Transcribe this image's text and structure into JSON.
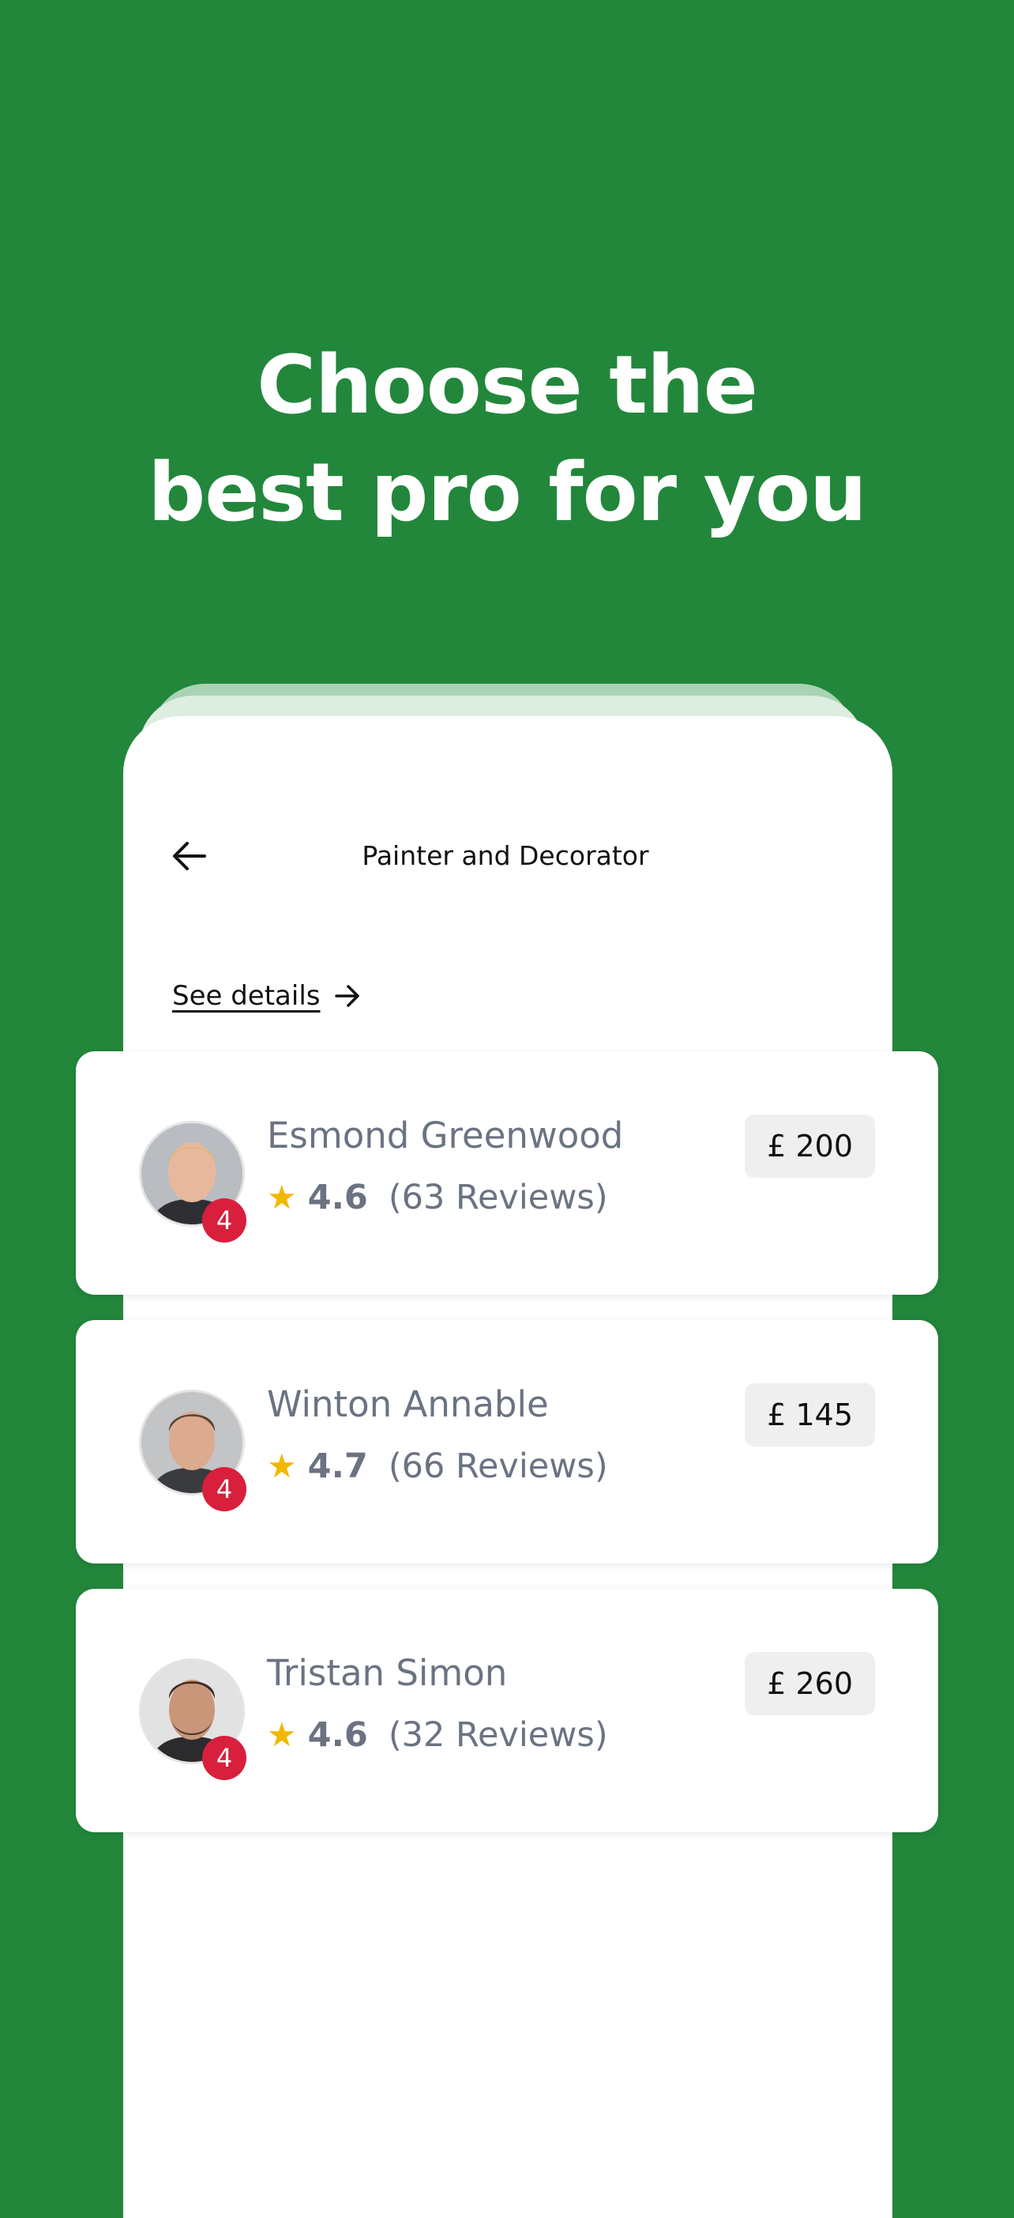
{
  "promo": {
    "headline_line1": "Choose the",
    "headline_line2": "best pro for you"
  },
  "screen": {
    "title": "Painter and Decorator",
    "back_icon": "arrow-left-icon",
    "see_details": "See details",
    "see_details_icon": "arrow-right-icon"
  },
  "pros": [
    {
      "name": "Esmond Greenwood",
      "rating": "4.6",
      "reviews": "(63 Reviews)",
      "price": "£ 200",
      "badge": "4"
    },
    {
      "name": "Winton Annable",
      "rating": "4.7",
      "reviews": "(66 Reviews)",
      "price": "£ 145",
      "badge": "4"
    },
    {
      "name": "Tristan Simon",
      "rating": "4.6",
      "reviews": "(32 Reviews)",
      "price": "£ 260",
      "badge": "4"
    }
  ],
  "colors": {
    "background_green": "#22873b",
    "badge_red": "#d81f3c",
    "star_yellow": "#f2b800",
    "muted_text": "#6b7382"
  }
}
